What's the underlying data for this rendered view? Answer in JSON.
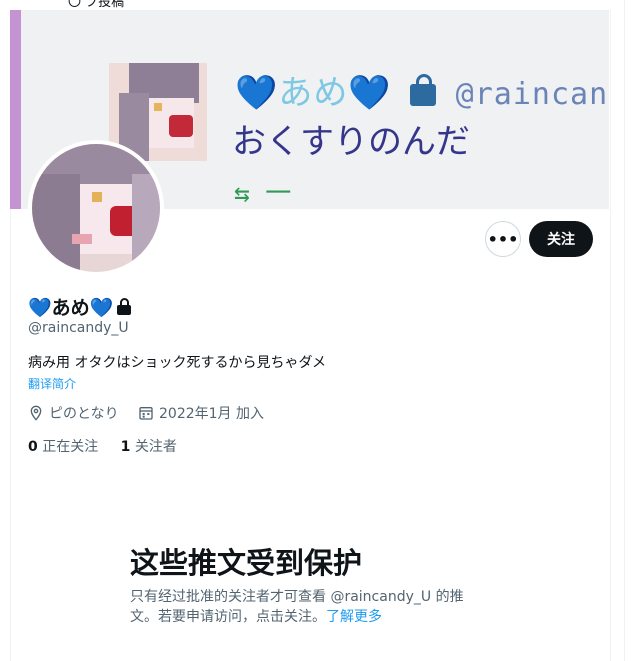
{
  "top_strip_text": "〇 プ投稿",
  "banner": {
    "line1_name": "💙あめ💙",
    "line1_handle": "@raincan",
    "line2": "おくすりのんだ",
    "actions": "⇆ 一"
  },
  "profile": {
    "display_name": "💙あめ💙",
    "handle": "@raincandy_U",
    "bio": "病み用 オタクはショック死するから見ちゃダメ",
    "translate_label": "翻译简介",
    "location": "ピのとなり",
    "joined": "2022年1月 加入",
    "following_count": "0",
    "following_label": " 正在关注",
    "followers_count": "1",
    "followers_label": " 关注者"
  },
  "buttons": {
    "more_label": "•••",
    "follow_label": "关注"
  },
  "protected": {
    "title": "这些推文受到保护",
    "desc": "只有经过批准的关注者才可查看 @raincandy_U 的推文。若要申请访问，点击关注。",
    "learn_more": "了解更多"
  },
  "colors": {
    "accent": "#1d9bf0",
    "text": "#0f1419",
    "muted": "#536471",
    "banner_stripe": "#c394d1",
    "banner_text": "#35358c"
  }
}
